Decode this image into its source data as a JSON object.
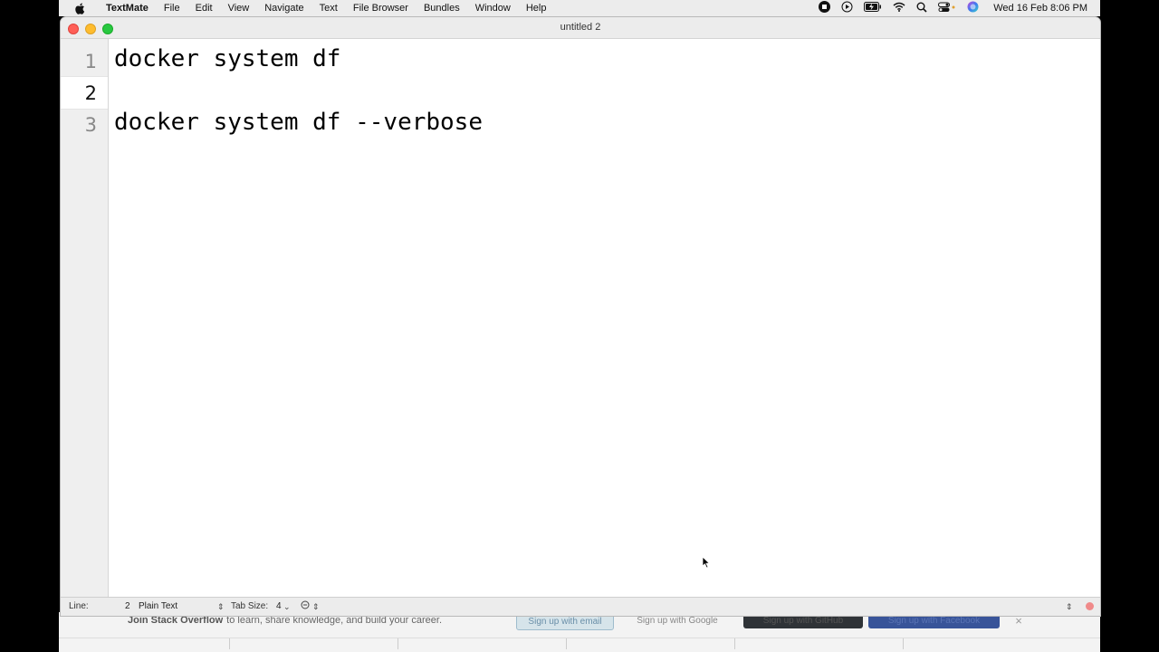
{
  "menubar": {
    "app_name": "TextMate",
    "menus": [
      "File",
      "Edit",
      "View",
      "Navigate",
      "Text",
      "File Browser",
      "Bundles",
      "Window",
      "Help"
    ],
    "clock": "Wed 16 Feb  8:06 PM"
  },
  "window": {
    "title": "untitled 2"
  },
  "editor": {
    "lines": [
      {
        "number": "1",
        "text": "docker system df"
      },
      {
        "number": "2",
        "text": ""
      },
      {
        "number": "3",
        "text": "docker system df --verbose"
      }
    ],
    "current_line": 2
  },
  "statusbar": {
    "line_label": "Line:",
    "line_value": "2",
    "grammar": "Plain Text",
    "tab_size_label": "Tab Size:",
    "tab_size_value": "4"
  },
  "background_page": {
    "join_strong": "Join Stack Overflow",
    "join_rest": "to learn, share knowledge, and build your career.",
    "buttons": [
      "Sign up with email",
      "Sign up with Google",
      "Sign up with GitHub",
      "Sign up with Facebook"
    ],
    "close": "×"
  },
  "colors": {
    "close": "#ff5f57",
    "minimize": "#febc2e",
    "maximize": "#28c840",
    "gutter": "#efefef",
    "menubar": "#ececec"
  }
}
